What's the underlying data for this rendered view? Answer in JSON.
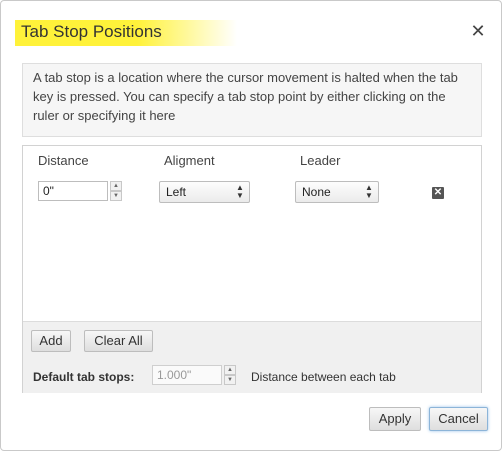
{
  "dialog": {
    "title": "Tab Stop Positions",
    "close_glyph": "✕",
    "info": "A tab stop is a location where the cursor movement is halted when the tab key is pressed. You can specify a tab stop point by either clicking on the ruler or specifying it here"
  },
  "table": {
    "headers": {
      "distance": "Distance",
      "alignment": "Aligment",
      "leader": "Leader"
    },
    "rows": [
      {
        "distance": "0\"",
        "alignment": "Left",
        "leader": "None"
      }
    ],
    "delete_glyph": "✕"
  },
  "panel_buttons": {
    "add": "Add",
    "clear_all": "Clear All"
  },
  "default_stops": {
    "label": "Default tab stops:",
    "value": "1.000\"",
    "note": "Distance between each tab"
  },
  "actions": {
    "apply": "Apply",
    "cancel": "Cancel"
  },
  "colors": {
    "title_highlight": "#fff23a",
    "focus_ring": "#9cc5ea"
  },
  "icons": {
    "close": "close-icon",
    "delete": "delete-icon",
    "spinner_up": "chevron-up-icon",
    "spinner_down": "chevron-down-icon",
    "select_arrows": "up-down-arrows-icon"
  }
}
